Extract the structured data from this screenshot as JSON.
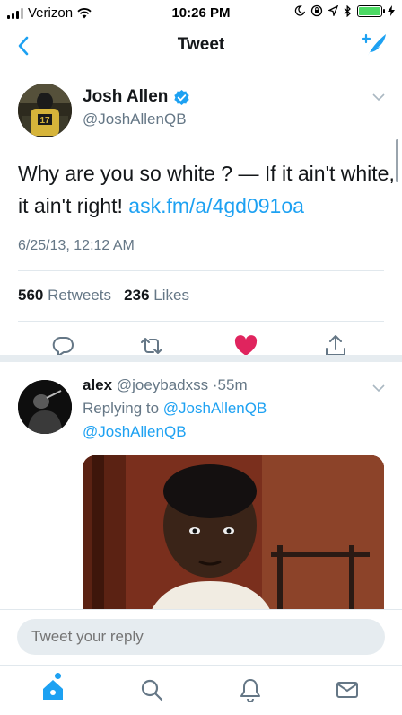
{
  "status_bar": {
    "carrier": "Verizon",
    "time": "10:26 PM"
  },
  "nav": {
    "title": "Tweet"
  },
  "tweet": {
    "author_name": "Josh Allen",
    "author_handle": "@JoshAllenQB",
    "text": "Why are you so white ? — If it ain't white, it ain't right!",
    "link": "ask.fm/a/4gd091oa",
    "timestamp": "6/25/13, 12:12 AM",
    "retweets_count": "560",
    "retweets_label": "Retweets",
    "likes_count": "236",
    "likes_label": "Likes"
  },
  "reply": {
    "name": "alex",
    "handle": "@joeybadxss",
    "separator": "·",
    "age": "55m",
    "replying_prefix": "Replying to",
    "replying_to": "@JoshAllenQB",
    "text": "@JoshAllenQB"
  },
  "composer": {
    "placeholder": "Tweet your reply"
  },
  "colors": {
    "accent": "#1da1f2",
    "like": "#e0245e",
    "verified": "#1da1f2"
  },
  "icons": [
    "back-chevron-icon",
    "compose-tweet-icon",
    "verified-icon",
    "reply-icon",
    "retweet-icon",
    "heart-icon",
    "share-icon",
    "home-icon",
    "search-icon",
    "notifications-icon",
    "messages-icon"
  ]
}
